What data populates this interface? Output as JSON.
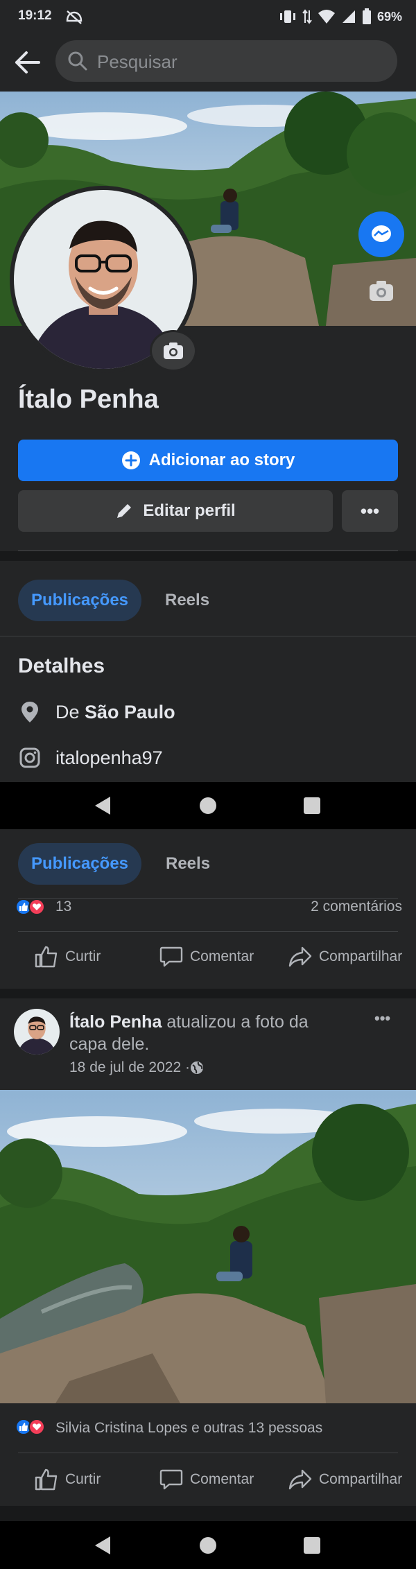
{
  "status_bar": {
    "time": "19:12",
    "battery": "69%"
  },
  "search": {
    "placeholder": "Pesquisar"
  },
  "profile": {
    "name": "Ítalo Penha",
    "add_story": "Adicionar ao story",
    "edit_profile": "Editar perfil",
    "more": "•••"
  },
  "tabs": {
    "posts": "Publicações",
    "reels": "Reels"
  },
  "details": {
    "title": "Detalhes",
    "location_prefix": "De ",
    "location_city": "São Paulo",
    "instagram": "italopenha97"
  },
  "post1": {
    "reaction_count": "13",
    "comments": "2 comentários",
    "actions": {
      "like": "Curtir",
      "comment": "Comentar",
      "share": "Compartilhar"
    }
  },
  "post2": {
    "author": "Ítalo Penha",
    "action_text_line1": " atualizou a foto da",
    "action_text_line2": "capa dele.",
    "date": "18 de jul de 2022 · ",
    "more": "•••",
    "reactions_text": "Silvia Cristina Lopes e outras 13 pessoas",
    "actions": {
      "like": "Curtir",
      "comment": "Comentar",
      "share": "Compartilhar"
    }
  },
  "colors": {
    "accent": "#1877f2",
    "surface": "#242526",
    "background": "#18191a"
  }
}
